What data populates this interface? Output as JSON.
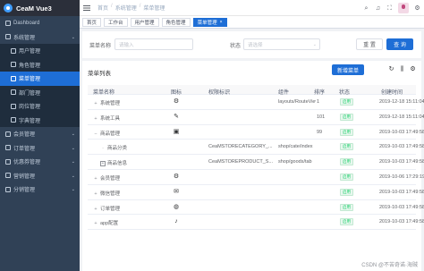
{
  "app": {
    "title": "CeaM Vue3"
  },
  "sidebar": {
    "items": [
      {
        "label": "Dashboard",
        "level": "top",
        "active": false,
        "expandable": false
      },
      {
        "label": "系统管理",
        "level": "top",
        "active": false,
        "expandable": true
      },
      {
        "label": "用户管理",
        "level": "sub",
        "active": false,
        "expandable": false
      },
      {
        "label": "角色管理",
        "level": "sub",
        "active": false,
        "expandable": false
      },
      {
        "label": "菜单管理",
        "level": "sub",
        "active": true,
        "expandable": false
      },
      {
        "label": "部门管理",
        "level": "sub",
        "active": false,
        "expandable": false
      },
      {
        "label": "岗位管理",
        "level": "sub",
        "active": false,
        "expandable": false
      },
      {
        "label": "字典管理",
        "level": "sub",
        "active": false,
        "expandable": false
      },
      {
        "label": "会员管理",
        "level": "top",
        "active": false,
        "expandable": true
      },
      {
        "label": "订单管理",
        "level": "top",
        "active": false,
        "expandable": true
      },
      {
        "label": "优惠券管理",
        "level": "top",
        "active": false,
        "expandable": true
      },
      {
        "label": "营销管理",
        "level": "top",
        "active": false,
        "expandable": true
      },
      {
        "label": "分销管理",
        "level": "top",
        "active": false,
        "expandable": true
      }
    ]
  },
  "navbar": {
    "breadcrumb": [
      "首页",
      "系统管理",
      "菜单管理"
    ]
  },
  "tags": [
    {
      "label": "首页",
      "active": false
    },
    {
      "label": "工作台",
      "active": false
    },
    {
      "label": "用户管理",
      "active": false
    },
    {
      "label": "角色管理",
      "active": false
    },
    {
      "label": "菜单管理",
      "active": true
    }
  ],
  "search": {
    "name_label": "菜单名称",
    "name_placeholder": "请输入",
    "status_label": "状态",
    "status_placeholder": "请选择",
    "reset_label": "重 置",
    "query_label": "查 询"
  },
  "table": {
    "title": "菜单列表",
    "add_label": "新增菜单",
    "headers": {
      "name": "菜单名称",
      "icon": "图标",
      "perm": "权限标识",
      "component": "组件",
      "sort": "排序",
      "status": "状态",
      "created": "创建时间"
    },
    "rows": [
      {
        "name": "系统管理",
        "expand": "+",
        "indent": 0,
        "icon": "⚙",
        "perm": "",
        "component": "layouts/RouteView",
        "sort": "1",
        "status": "启用",
        "created": "2019-12-18 15:11:04"
      },
      {
        "name": "系统工具",
        "expand": "+",
        "indent": 0,
        "icon": "✎",
        "perm": "",
        "component": "",
        "sort": "101",
        "status": "启用",
        "created": "2019-12-18 15:11:04"
      },
      {
        "name": "商品管理",
        "expand": "−",
        "indent": 0,
        "icon": "▣",
        "perm": "",
        "component": "",
        "sort": "99",
        "status": "启用",
        "created": "2019-10-03 17:49:58"
      },
      {
        "name": "商品分类",
        "expand": "·",
        "indent": 1,
        "icon": "",
        "perm": "CeaMSTORECATEGORY_...",
        "component": "shop/cate/index",
        "sort": "",
        "status": "启用",
        "created": "2019-10-03 17:49:58"
      },
      {
        "name": "商品信息",
        "expand": "+",
        "indent": 1,
        "icon": "",
        "perm": "CeaMSTOREPRODUCT_S...",
        "component": "shop/goods/tab",
        "sort": "",
        "status": "启用",
        "created": "2019-10-03 17:49:58"
      },
      {
        "name": "会员管理",
        "expand": "+",
        "indent": 0,
        "icon": "⚙",
        "perm": "",
        "component": "",
        "sort": "",
        "status": "启用",
        "created": "2019-10-06 17:29:19"
      },
      {
        "name": "微信管理",
        "expand": "+",
        "indent": 0,
        "icon": "✉",
        "perm": "",
        "component": "",
        "sort": "",
        "status": "启用",
        "created": "2019-10-03 17:49:58"
      },
      {
        "name": "订单管理",
        "expand": "+",
        "indent": 0,
        "icon": "◍",
        "perm": "",
        "component": "",
        "sort": "",
        "status": "启用",
        "created": "2019-10-03 17:49:58"
      },
      {
        "name": "app配置",
        "expand": "+",
        "indent": 0,
        "icon": "♪",
        "perm": "",
        "component": "",
        "sort": "",
        "status": "启用",
        "created": "2019-10-03 17:49:58"
      }
    ]
  },
  "watermark": "CSDN @不苦奇诺·海贼"
}
